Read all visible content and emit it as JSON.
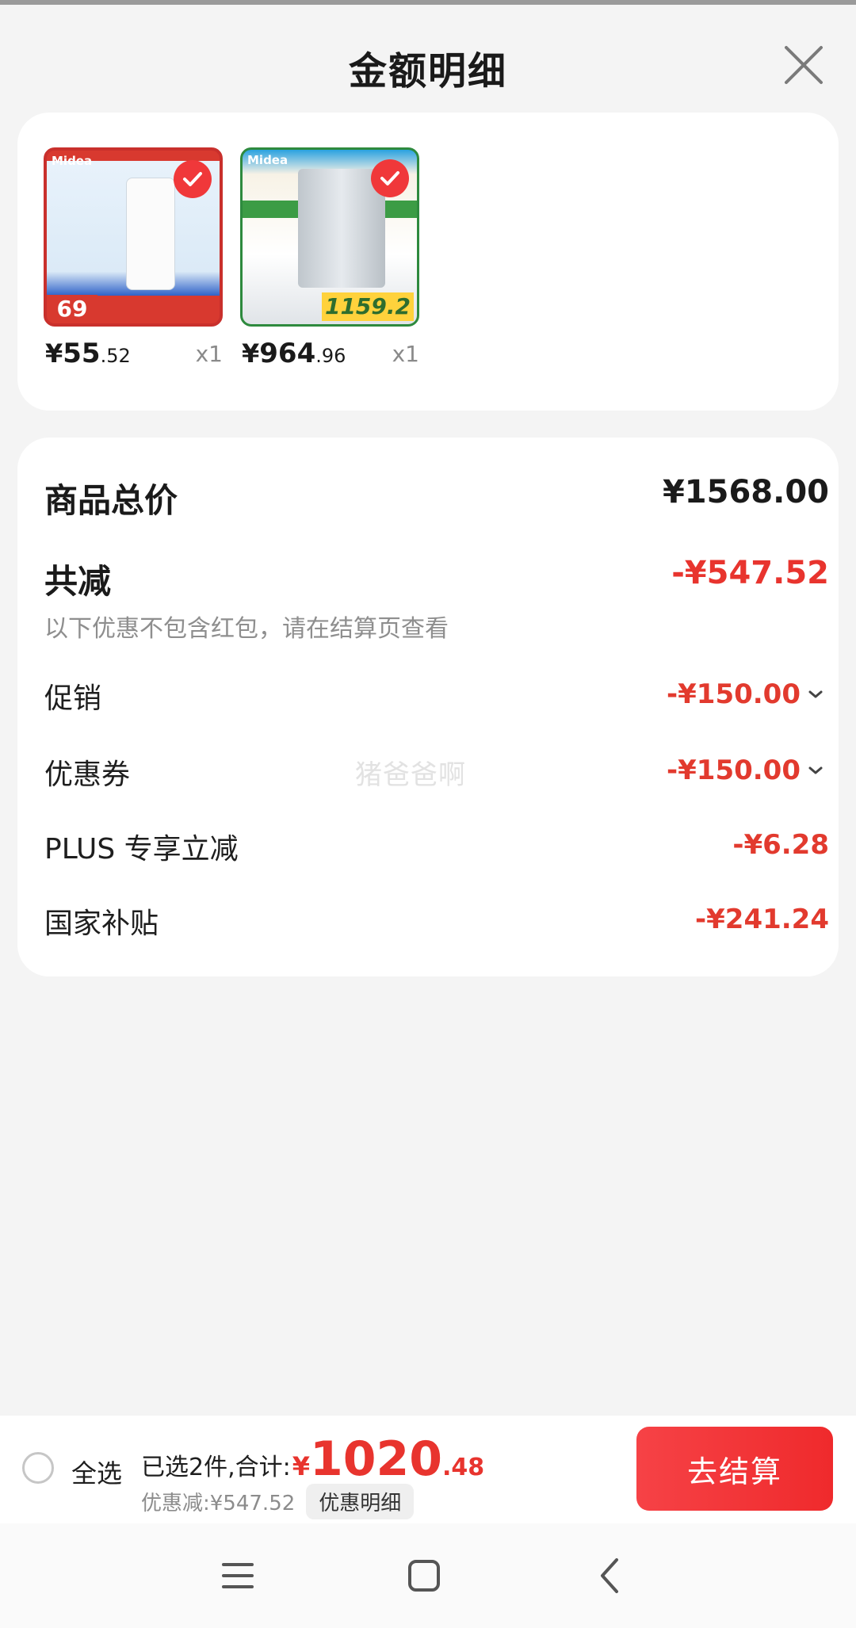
{
  "header": {
    "title": "金额明细"
  },
  "products": [
    {
      "price_symbol": "¥",
      "price_int": "55",
      "price_dec": ".52",
      "qty": "x1",
      "brand": "Midea",
      "badge": "69"
    },
    {
      "price_symbol": "¥",
      "price_int": "964",
      "price_dec": ".96",
      "qty": "x1",
      "brand": "Midea",
      "badge": "1159.2"
    }
  ],
  "detail": {
    "total_label": "商品总价",
    "total_value": "¥1568.00",
    "reduce_label": "共减",
    "reduce_value": "-¥547.52",
    "reduce_note": "以下优惠不包含红包，请在结算页查看",
    "items": [
      {
        "label": "促销",
        "value": "-¥150.00"
      },
      {
        "label": "优惠券",
        "value": "-¥150.00"
      },
      {
        "label": "PLUS 专享立减",
        "value": "-¥6.28"
      },
      {
        "label": "国家补贴",
        "value": "-¥241.24"
      }
    ],
    "watermark": "猪爸爸啊"
  },
  "bottom": {
    "select_all": "全选",
    "summary_text": "已选2件,合计:",
    "summary_symbol": "¥",
    "summary_int": "1020",
    "summary_dec": ".48",
    "discount_text": "优惠减:¥547.52",
    "detail_chip": "优惠明细",
    "checkout": "去结算"
  },
  "colors": {
    "accent_red": "#e8342e",
    "checkout_red": "#f64246"
  },
  "icons": {
    "close": "close-icon",
    "check": "checkmark-icon",
    "chevron": "chevron-down-icon",
    "nav": [
      "menu-icon",
      "home-square-icon",
      "back-icon"
    ]
  }
}
